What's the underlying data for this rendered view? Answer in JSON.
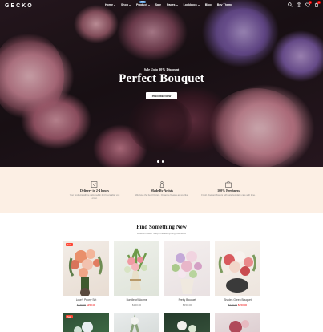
{
  "brand": {
    "logo": "GECKO"
  },
  "nav": {
    "items": [
      {
        "label": "Home",
        "badge": ""
      },
      {
        "label": "Shop",
        "badge": ""
      },
      {
        "label": "Product",
        "badge": "Hot"
      },
      {
        "label": "Sale",
        "badge": ""
      },
      {
        "label": "Pages",
        "badge": ""
      },
      {
        "label": "Lookbook",
        "badge": ""
      },
      {
        "label": "Blog",
        "badge": ""
      },
      {
        "label": "Buy Theme",
        "badge": ""
      }
    ]
  },
  "header_icons": {
    "search": "search-icon",
    "account": "user-icon",
    "wishlist": "heart-icon",
    "wishlist_count": "0",
    "cart": "cart-icon",
    "cart_count": "0"
  },
  "hero": {
    "subtitle": "Sale Upto 30% Discount",
    "title": "Perfect Bouquet",
    "button_label": "PREORDER NOW",
    "slides": 2,
    "active_slide": 1
  },
  "features": [
    {
      "icon": "delivery-icon",
      "title": "Delivery in 2-4 hours",
      "desc": "Your products will be delivered in 2-4 hours after you order."
    },
    {
      "icon": "vase-icon",
      "title": "Made By Artists",
      "desc": "We have the best Florists, Organize flowers as you like."
    },
    {
      "icon": "leaf-box-icon",
      "title": "100% Freshness",
      "desc": "Fresh, fragrant flowers with selected daily care with time."
    }
  ],
  "section": {
    "title": "Find Something New",
    "subtitle": "Browse Flower Shop Find Everything You Need"
  },
  "products": [
    {
      "name": "Love's Peony Set",
      "price": "$150.00",
      "old_price": "$170.00",
      "sale_badge": "Sale",
      "on_sale": true
    },
    {
      "name": "Bundle of Blooms",
      "price": "$150.00",
      "old_price": "",
      "sale_badge": "",
      "on_sale": false
    },
    {
      "name": "Pretty Bouquet",
      "price": "$150.00",
      "old_price": "",
      "sale_badge": "",
      "on_sale": false
    },
    {
      "name": "Shades Green Bouquet",
      "price": "$150.00",
      "old_price": "$170.00",
      "sale_badge": "",
      "on_sale": true
    }
  ],
  "row2_products": [
    {
      "sale_badge": "Sale"
    },
    {
      "sale_badge": ""
    },
    {
      "sale_badge": ""
    },
    {
      "sale_badge": ""
    }
  ],
  "colors": {
    "accent": "#ec0101",
    "feature_bg": "#fcefe4",
    "hot_badge": "#62a4e3"
  }
}
